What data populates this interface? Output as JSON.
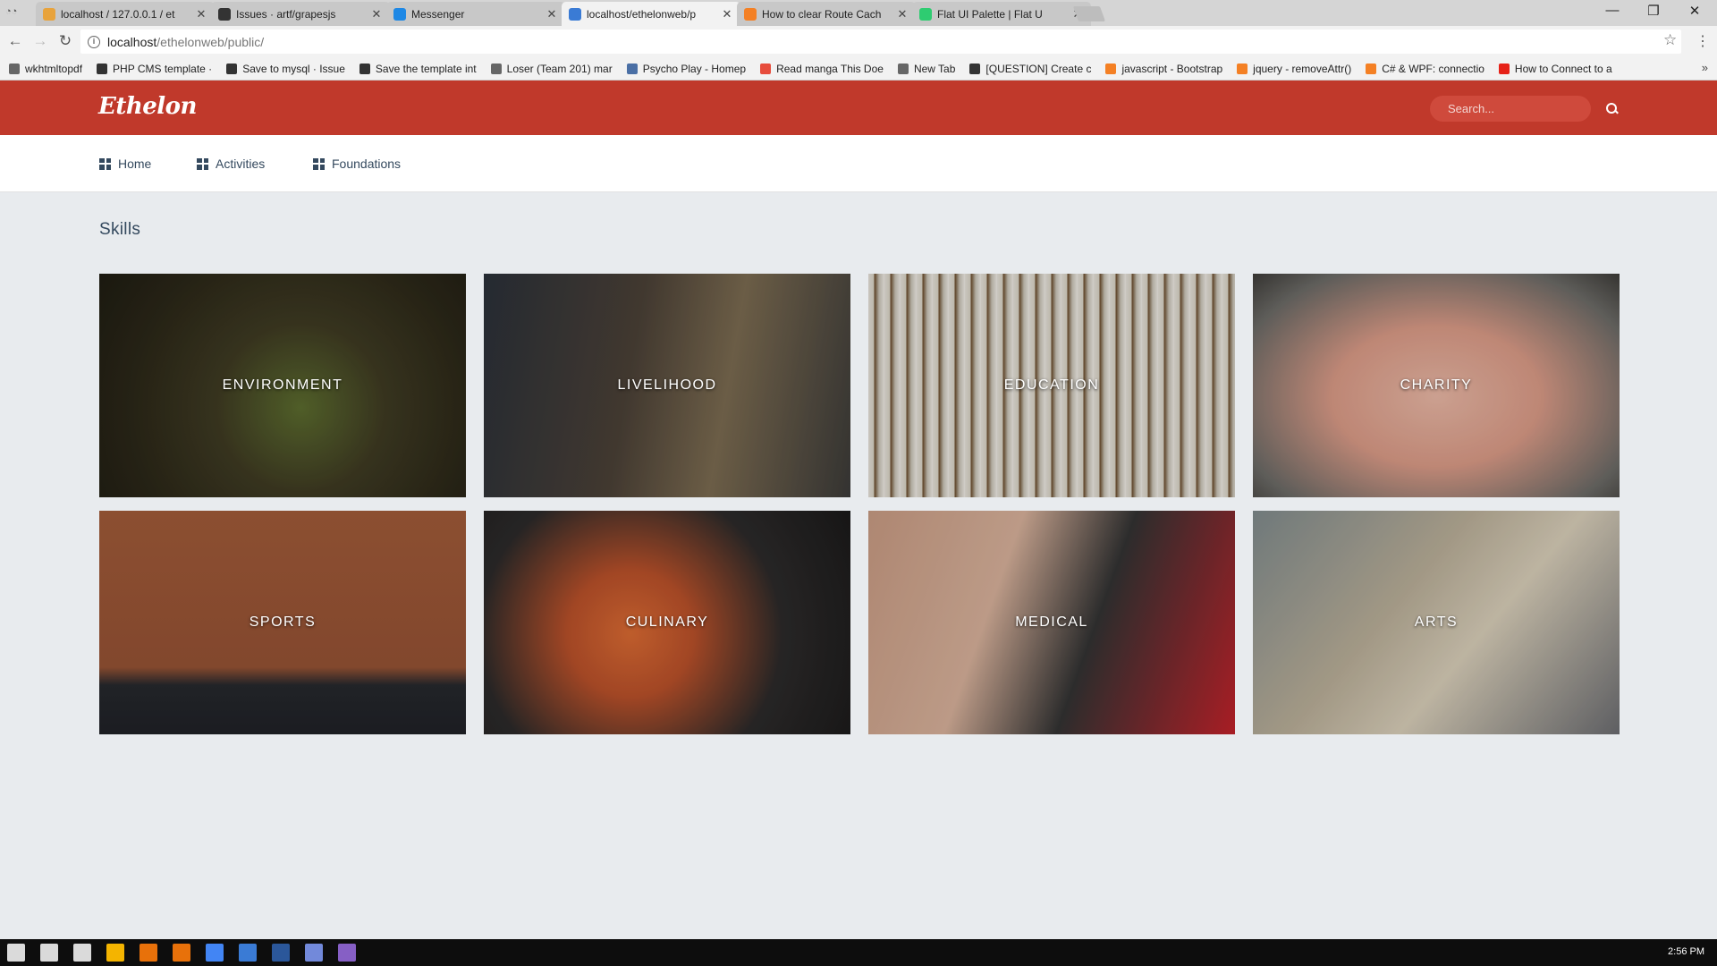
{
  "browser": {
    "tabs": [
      {
        "title": "localhost / 127.0.0.1 / et",
        "color": "#e8a33c"
      },
      {
        "title": "Issues · artf/grapesjs",
        "color": "#333333"
      },
      {
        "title": "Messenger",
        "color": "#1e88e5"
      },
      {
        "title": "localhost/ethelonweb/p",
        "color": "#3a7bd5"
      },
      {
        "title": "How to clear Route Cach",
        "color": "#f48024"
      },
      {
        "title": "Flat UI Palette | Flat U",
        "color": "#2ecc71"
      }
    ],
    "url_host": "localhost",
    "url_path": "/ethelonweb/public/",
    "bookmarks": [
      {
        "label": "wkhtmltopdf",
        "color": "#666666"
      },
      {
        "label": "PHP CMS template ·",
        "color": "#333333"
      },
      {
        "label": "Save to mysql · Issue",
        "color": "#333333"
      },
      {
        "label": "Save the template int",
        "color": "#333333"
      },
      {
        "label": "Loser (Team 201) mar",
        "color": "#666666"
      },
      {
        "label": "Psycho Play - Homep",
        "color": "#4a6fa5"
      },
      {
        "label": "Read manga This Doe",
        "color": "#e74c3c"
      },
      {
        "label": "New Tab",
        "color": "#666666"
      },
      {
        "label": "[QUESTION] Create c",
        "color": "#333333"
      },
      {
        "label": "javascript - Bootstrap",
        "color": "#f48024"
      },
      {
        "label": "jquery - removeAttr()",
        "color": "#f48024"
      },
      {
        "label": "C# & WPF: connectio",
        "color": "#f48024"
      },
      {
        "label": "How to Connect to a",
        "color": "#e62117"
      }
    ],
    "bookmarks_more": "»"
  },
  "site": {
    "brand": "Ethelon",
    "search_placeholder": "Search...",
    "nav": [
      {
        "label": "Home"
      },
      {
        "label": "Activities"
      },
      {
        "label": "Foundations"
      }
    ],
    "section_title": "Skills",
    "skills": [
      {
        "label": "ENVIRONMENT",
        "bg": "radial-gradient(circle at 55% 60%, #5b6b2e 0%, #3e3a22 35%, #2b2718 70%, #1e1c12 100%)"
      },
      {
        "label": "LIVELIHOOD",
        "bg": "linear-gradient(100deg, #2a3038 0%, #4a4036 40%, #7a6a50 65%, #3b3a38 100%)"
      },
      {
        "label": "EDUCATION",
        "bg": "repeating-linear-gradient(90deg, #e6e2da 0px, #d8d2c4 6px, #6b4e2e 7px, #c9c3b6 12px, #efece6 18px)"
      },
      {
        "label": "CHARITY",
        "bg": "radial-gradient(ellipse at 50% 55%, #e7b6a4 0%, #d99a86 40%, #6b6a66 80%, #3d3b38 100%)"
      },
      {
        "label": "SPORTS",
        "bg": "linear-gradient(180deg, #a05a38 0%, #955234 70%, #26282d 78%, #1f2126 100%)"
      },
      {
        "label": "CULINARY",
        "bg": "radial-gradient(circle at 40% 55%, #d96a32 0%, #b8502a 25%, #2c2a2a 60%, #1a1919 100%)"
      },
      {
        "label": "MEDICAL",
        "bg": "linear-gradient(110deg, #c79a82 0%, #d6b09a 35%, #333333 60%, #c0222a 100%)"
      },
      {
        "label": "ARTS",
        "bg": "linear-gradient(130deg, #7f8a8c 0%, #b9ae98 40%, #d7cdb8 60%, #6b6c70 100%)"
      }
    ]
  },
  "os": {
    "clock": "2:56 PM",
    "taskbar_icons": [
      "#ffffff",
      "#ffffff",
      "#ffffff",
      "#f4b400",
      "#e8710a",
      "#e8710a",
      "#4285f4",
      "#3a7bd5",
      "#2b579a",
      "#7289da",
      "#865fc5"
    ]
  }
}
